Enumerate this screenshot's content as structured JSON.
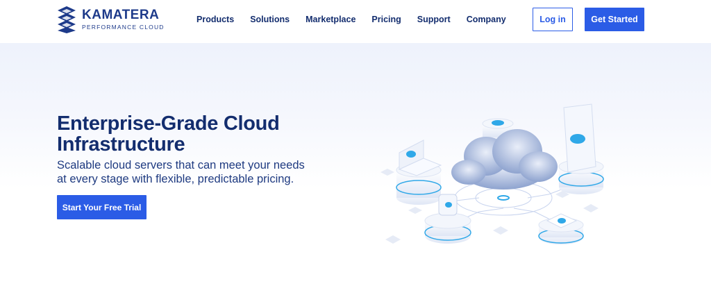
{
  "brand": {
    "name": "KAMATERA",
    "tagline": "PERFORMANCE CLOUD"
  },
  "nav": {
    "items": [
      "Products",
      "Solutions",
      "Marketplace",
      "Pricing",
      "Support",
      "Company"
    ]
  },
  "header": {
    "login_label": "Log in",
    "get_started_label": "Get Started"
  },
  "hero": {
    "title": "Enterprise-Grade Cloud Infrastructure",
    "subtitle": "Scalable cloud servers that can meet your needs at every stage with flexible, predictable pricing.",
    "cta_label": "Start Your Free Trial"
  },
  "colors": {
    "brand_blue": "#2b5ce6",
    "navy": "#132d6e",
    "cloud_accent": "#2fa8e8"
  },
  "icons": [
    "kamatera-logo-icon",
    "cloud-illustration"
  ]
}
